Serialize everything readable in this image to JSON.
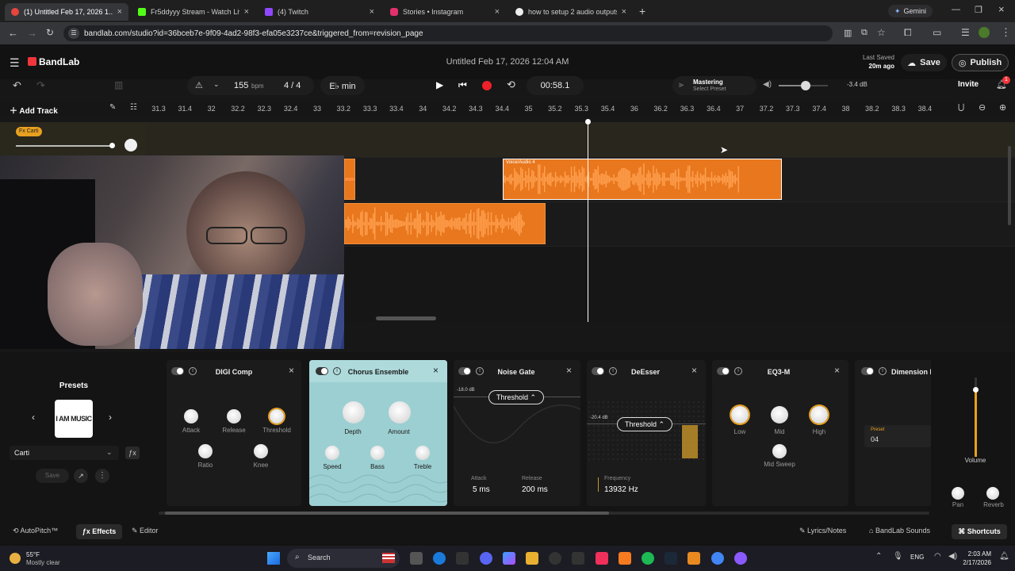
{
  "browser": {
    "tabs": [
      {
        "title": "(1) Untitled Feb 17, 2026 1...",
        "color": "#e8453c",
        "active": true
      },
      {
        "title": "Fr5ddyyy Stream - Watch Live ...",
        "color": "#53fc18",
        "active": false
      },
      {
        "title": "(4) Twitch",
        "color": "#9146ff",
        "active": false
      },
      {
        "title": "Stories • Instagram",
        "color": "#e1306c",
        "active": false
      },
      {
        "title": "how to setup 2 audio outputs ...",
        "color": "#eeeeee",
        "active": false
      }
    ],
    "gemini_label": "Gemini",
    "url": "bandlab.com/studio?id=36bceb7e-9f09-4ad2-98f3-efa05e3237ce&triggered_from=revision_page"
  },
  "app": {
    "brand": "BandLab",
    "project_title": "Untitled Feb 17, 2026 12:04 AM",
    "last_saved_label": "Last Saved",
    "last_saved_value": "20m ago",
    "save_label": "Save",
    "publish_label": "Publish",
    "invite_label": "Invite",
    "notification_count": "1",
    "bpm_value": "155",
    "bpm_unit": "bpm",
    "time_sig": "4 / 4",
    "key": "E♭ min",
    "time_display": "00:58.1",
    "mastering_label": "Mastering",
    "mastering_preset": "Select Preset",
    "master_volume": "-3.4 dB",
    "master_volume_level": 0.55,
    "add_track_label": "Add Track",
    "ruler_ticks": [
      "31.3",
      "31.4",
      "32",
      "32.2",
      "32.3",
      "32.4",
      "33",
      "33.2",
      "33.3",
      "33.4",
      "34",
      "34.2",
      "34.3",
      "34.4",
      "35",
      "35.2",
      "35.3",
      "35.4",
      "36",
      "36.2",
      "36.3",
      "36.4",
      "37",
      "37.2",
      "37.3",
      "37.4",
      "38",
      "38.2",
      "38.3",
      "38.4"
    ],
    "track_fx_badge": "Fx Carti",
    "clip_label": "Voice/Audio 4"
  },
  "presets": {
    "title": "Presets",
    "thumb_text": "I AM MUSIC",
    "selected": "Carti",
    "save_label": "Save"
  },
  "effects": [
    {
      "name": "DIGI Comp",
      "knobs": [
        "Attack",
        "Release",
        "Threshold",
        "Ratio",
        "Knee"
      ]
    },
    {
      "name": "Chorus Ensemble",
      "knobs": [
        "Depth",
        "Amount",
        "Speed",
        "Bass",
        "Treble"
      ]
    },
    {
      "name": "Noise Gate",
      "threshold_db": "-18.0 dB",
      "threshold_label": "Threshold",
      "attack_label": "Attack",
      "attack_value": "5 ms",
      "release_label": "Release",
      "release_value": "200 ms"
    },
    {
      "name": "DeEsser",
      "threshold_db": "-20.4 dB",
      "threshold_label": "Threshold",
      "freq_label": "Frequency",
      "freq_value": "13932 Hz"
    },
    {
      "name": "EQ3-M",
      "knobs": [
        "Low",
        "Mid",
        "High",
        "Mid Sweep"
      ]
    },
    {
      "name": "Dimension I",
      "preset_label": "Preset",
      "preset_value": "04"
    }
  ],
  "mixer": {
    "volume_label": "Volume",
    "pan_label": "Pan",
    "reverb_label": "Reverb",
    "volume_level": 0.85
  },
  "bottom": {
    "autopitch": "AutoPitch™",
    "effects": "Effects",
    "editor": "Editor",
    "lyrics": "Lyrics/Notes",
    "sounds": "BandLab Sounds",
    "shortcuts": "Shortcuts"
  },
  "taskbar": {
    "temp": "55°F",
    "weather": "Mostly clear",
    "search": "Search",
    "lang": "ENG",
    "time": "2:03 AM",
    "date": "2/17/2026"
  }
}
